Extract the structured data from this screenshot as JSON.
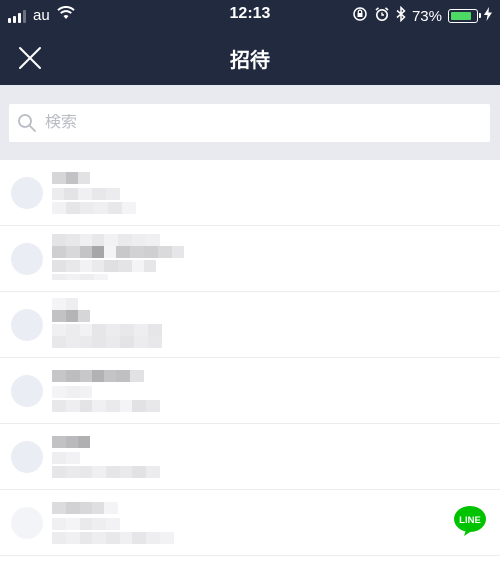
{
  "status_bar": {
    "carrier": "au",
    "time": "12:13",
    "battery_percent": "73%",
    "battery_level": 0.73,
    "icons": [
      "signal-icon",
      "wifi-icon",
      "orientation-lock-icon",
      "alarm-icon",
      "bluetooth-icon",
      "battery-icon",
      "charging-icon"
    ]
  },
  "header": {
    "title": "招待",
    "close_icon": "close-icon"
  },
  "search": {
    "placeholder": "検索",
    "value": ""
  },
  "friends": {
    "row_count": 6,
    "names_blurred": true,
    "last_row_badge": "LINE"
  },
  "colors": {
    "header_bg": "#212a3e",
    "search_area_bg": "#e9eaf0",
    "avatar_bg": "#ebedf5",
    "line_green": "#00c300",
    "battery_green": "#4cd964"
  }
}
